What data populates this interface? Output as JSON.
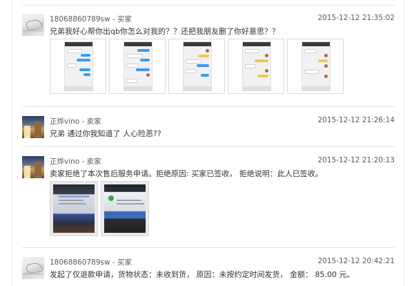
{
  "comments": [
    {
      "username": "18068860789sw - 买家",
      "timestamp": "2015-12-12 21:35:02",
      "message": "兄弟我好心帮你出qb你怎么对我的？？还把我朋友删了你好意思？？",
      "avatar": "sketch-avatar-image",
      "attachments": [
        "chat-screenshot-1",
        "chat-screenshot-2",
        "chat-screenshot-3",
        "chat-screenshot-4",
        "chat-screenshot-5"
      ]
    },
    {
      "username": "正烨vino - 卖家",
      "timestamp": "2015-12-12 21:26:14",
      "message": "兄弟 通过你我知道了 人心险恶??",
      "avatar": "photo-avatar-image"
    },
    {
      "username": "正烨vino - 卖家",
      "timestamp": "2015-12-12 21:20:13",
      "message": "卖家拒绝了本次售后服务申请。拒绝原因: 买家已签收， 拒绝说明：此人已签收。",
      "avatar": "photo-avatar-image",
      "attachments": [
        "monitor-photo-1",
        "monitor-photo-2"
      ]
    },
    {
      "username": "18068860789sw - 买家",
      "timestamp": "2015-12-12 20:42:21",
      "message": "发起了仅退款申请，货物状态：未收到货， 原因：未按约定时间发货， 金额： 85.00 元。",
      "avatar": "sketch-avatar-image"
    }
  ],
  "colors": {
    "meta_text": "#5a5a5a",
    "body_text": "#333333",
    "divider": "#e4e4e4"
  }
}
